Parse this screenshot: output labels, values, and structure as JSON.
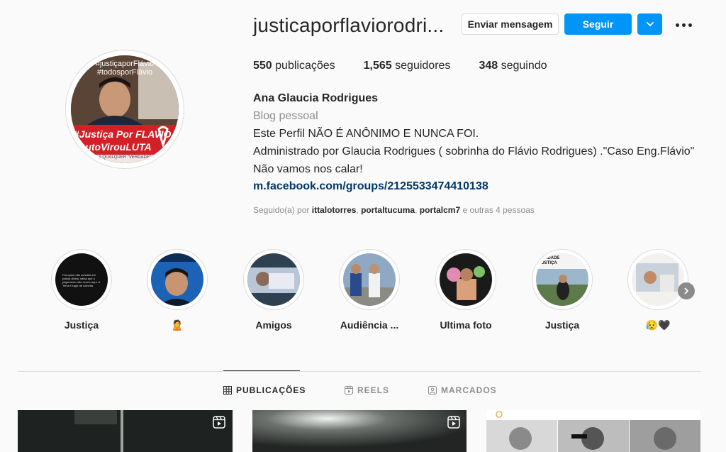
{
  "profile": {
    "username": "justicaporflaviorodri...",
    "message_label": "Enviar mensagem",
    "follow_label": "Seguir",
    "stats": {
      "posts_count": "550",
      "posts_label": "publicações",
      "followers_count": "1,565",
      "followers_label": "seguidores",
      "following_count": "348",
      "following_label": "seguindo"
    },
    "full_name": "Ana Glaucia Rodrigues",
    "category": "Blog pessoal",
    "bio_lines": [
      "Este Perfil NÃO É ANÔNIMO E NUNCA FOI.",
      "Administrado por Glaucia Rodrigues ( sobrinha do Flávio Rodrigues) .\"Caso Eng.Flávio\"",
      "Não vamos nos calar!"
    ],
    "link": "m.facebook.com/groups/2125533474410138",
    "followed_by": {
      "prefix": "Seguido(a) por",
      "users": [
        "ittalotorres",
        "portaltucuma",
        "portalcm7"
      ],
      "suffix": "e outras 4 pessoas"
    },
    "avatar": {
      "top_text_1": "#justiçaporFlávio",
      "top_text_2": "#todosporFlávio",
      "banner_text_1": "#Justiça Por FLAVIO",
      "banner_text_2": "#LutoVirouLUTA",
      "footer_text": "A QUALQUER \"VERDADE\""
    }
  },
  "highlights": [
    {
      "label": "Justiça",
      "image_text": "Pra quem não acredita em justiça divina, saiba que o julgamento não ocorre aqui. A Terra é lugar de colheita."
    },
    {
      "label": "🙎"
    },
    {
      "label": "Amigos"
    },
    {
      "label": "Audiência ..."
    },
    {
      "label": "Ultima foto"
    },
    {
      "label": "Justiça",
      "image_text": "VERDADE JUSTIÇA"
    },
    {
      "label": "😥🖤"
    }
  ],
  "tabs": [
    {
      "label": "PUBLICAÇÕES",
      "icon": "grid-icon",
      "active": true
    },
    {
      "label": "REELS",
      "icon": "reels-icon",
      "active": false
    },
    {
      "label": "MARCADOS",
      "icon": "tagged-icon",
      "active": false
    }
  ],
  "colors": {
    "primary_button": "#0095f6",
    "link": "#00376b",
    "secondary_text": "#8e8e8e",
    "border": "#dbdbdb",
    "avatar_banner": "#d41f26"
  }
}
